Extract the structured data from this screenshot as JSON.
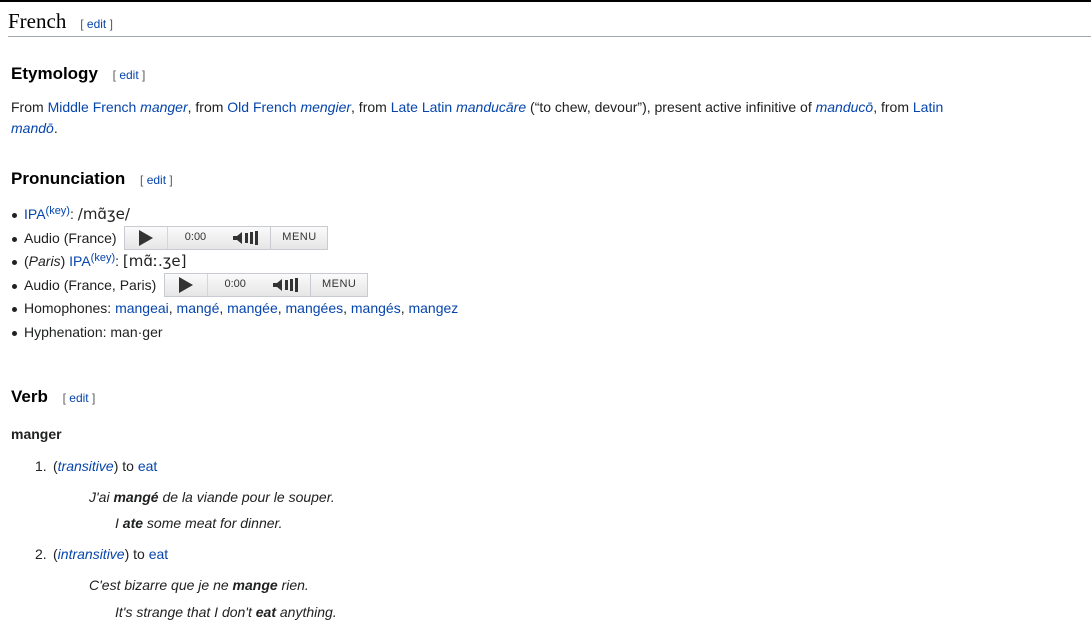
{
  "section": {
    "title": "French",
    "edit_open": "[ ",
    "edit": "edit",
    "edit_close": " ]"
  },
  "etymology": {
    "heading": "Etymology",
    "text": {
      "t1": "From ",
      "l1": "Middle French",
      "t2": " ",
      "i1": "manger",
      "t3": ", from ",
      "l2": "Old French",
      "t4": " ",
      "i2": "mengier",
      "t5": ", from ",
      "l3": "Late Latin",
      "t6": " ",
      "i3": "manducāre",
      "t7": " (“to chew, devour”), present active infinitive of ",
      "i4": "manducō",
      "t8": ", from ",
      "l4": "Latin",
      "i5": "mandō",
      "t9": "."
    }
  },
  "pronunciation": {
    "heading": "Pronunciation",
    "ipa1": {
      "link": "IPA",
      "key": "(key)",
      "sep": ": ",
      "value": "/mɑ̃ʒe/"
    },
    "audio1": {
      "label": "Audio (France)"
    },
    "ipa2": {
      "pre": "(",
      "place": "Paris",
      "post": ") ",
      "link": "IPA",
      "key": "(key)",
      "sep": ": ",
      "value": "[mɑ̃ː.ʒe]"
    },
    "audio2": {
      "label": "Audio (France, Paris)"
    },
    "player": {
      "time": "0:00",
      "menu": "MENU"
    },
    "homophones": {
      "label": "Homophones: ",
      "items": [
        "mangeai",
        "mangé",
        "mangée",
        "mangées",
        "mangés",
        "mangez"
      ],
      "sep": ", "
    },
    "hyphenation": "Hyphenation: man·ger"
  },
  "verb": {
    "heading": "Verb",
    "headword": "manger",
    "senses": [
      {
        "num": "1.",
        "open": "(",
        "label": "transitive",
        "close": ") to ",
        "gloss": "eat",
        "ex_pre": "J'ai ",
        "ex_bold": "mangé",
        "ex_post": " de la viande pour le souper.",
        "tr_pre": "I ",
        "tr_bold": "ate",
        "tr_post": " some meat for dinner."
      },
      {
        "num": "2.",
        "open": "(",
        "label": "intransitive",
        "close": ") to ",
        "gloss": "eat",
        "ex_pre": "C'est bizarre que je ne ",
        "ex_bold": "mange",
        "ex_post": " rien.",
        "tr_pre": "It's strange that I don't ",
        "tr_bold": "eat",
        "tr_post": " anything."
      }
    ]
  }
}
